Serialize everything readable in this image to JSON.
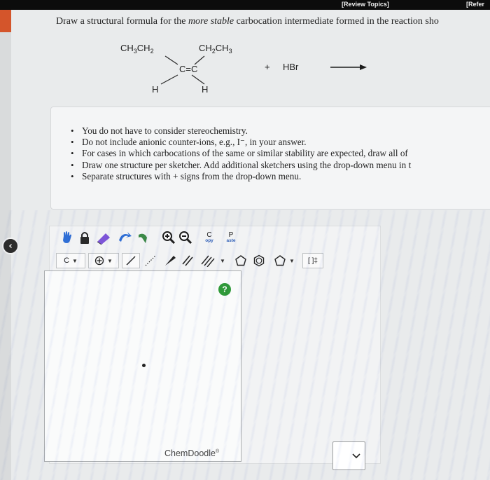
{
  "topbar": {
    "review_topics": "[Review Topics]",
    "references": "[Refer"
  },
  "question": {
    "prompt_before": "Draw a structural formula for the ",
    "prompt_emph": "more stable",
    "prompt_after": " carbocation intermediate formed in the reaction sho",
    "reaction": {
      "left_top": "CH3CH2",
      "right_top": "CH2CH3",
      "center": "C=C",
      "left_bottom": "H",
      "right_bottom": "H",
      "plus": "+",
      "reagent": "HBr"
    }
  },
  "instructions": [
    "You do not have to consider stereochemistry.",
    "Do not include anionic counter-ions, e.g., I⁻, in your answer.",
    "For cases in which carbocations of the same or similar stability are expected, draw all of",
    "Draw one structure per sketcher. Add additional sketchers using the drop-down menu in t",
    "Separate structures with + signs from the drop-down menu."
  ],
  "toolbar": {
    "copy_letter": "C",
    "copy_sub": "opy",
    "paste_letter": "P",
    "paste_sub": "aste",
    "element_label": "C",
    "bracket_label": "[ ]‡"
  },
  "sketcher": {
    "brand": "ChemDoodle",
    "brand_mark": "®",
    "help": "?"
  },
  "colors": {
    "accent_blue": "#2f6fd6",
    "help_green": "#2f9a3a",
    "tab_orange": "#d4552b"
  }
}
